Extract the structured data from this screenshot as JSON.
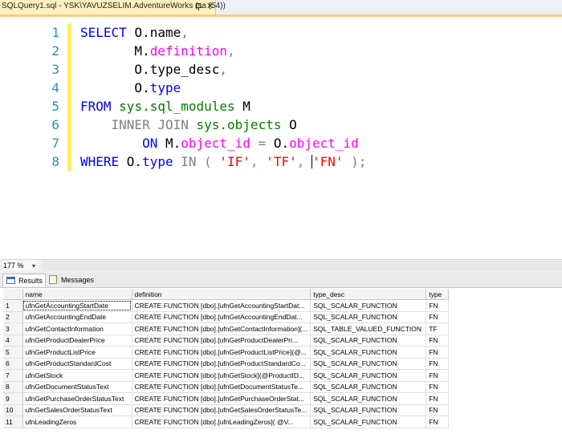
{
  "document_tab": {
    "title": "SQLQuery1.sql - YSK\\YAVUZSELIM.AdventureWorks (sa (54))",
    "pin_icon": "pin-icon",
    "close_label": "✕"
  },
  "editor": {
    "line_numbers": [
      "1",
      "2",
      "3",
      "4",
      "5",
      "6",
      "7",
      "8"
    ],
    "lines": [
      [
        {
          "t": "SELECT ",
          "c": "kw"
        },
        {
          "t": "O.name",
          "c": ""
        },
        {
          "t": ",",
          "c": "gray"
        }
      ],
      [
        {
          "t": "       M.",
          "c": ""
        },
        {
          "t": "definition",
          "c": "fn"
        },
        {
          "t": ",",
          "c": "gray"
        }
      ],
      [
        {
          "t": "       O.type_desc",
          "c": ""
        },
        {
          "t": ",",
          "c": "gray"
        }
      ],
      [
        {
          "t": "       O.",
          "c": ""
        },
        {
          "t": "type",
          "c": "kw"
        }
      ],
      [
        {
          "t": "FROM ",
          "c": "kw"
        },
        {
          "t": "sys.sql_modules",
          "c": "sys"
        },
        {
          "t": " M",
          "c": ""
        }
      ],
      [
        {
          "t": "    ",
          "c": ""
        },
        {
          "t": "INNER JOIN ",
          "c": "gray"
        },
        {
          "t": "sys.objects",
          "c": "sys"
        },
        {
          "t": " O",
          "c": ""
        }
      ],
      [
        {
          "t": "        ",
          "c": ""
        },
        {
          "t": "ON ",
          "c": "kw"
        },
        {
          "t": "M.",
          "c": ""
        },
        {
          "t": "object_id",
          "c": "fn"
        },
        {
          "t": " = ",
          "c": "gray"
        },
        {
          "t": "O.",
          "c": ""
        },
        {
          "t": "object_id",
          "c": "fn"
        }
      ],
      [
        {
          "t": "WHERE ",
          "c": "kw"
        },
        {
          "t": "O.",
          "c": ""
        },
        {
          "t": "type",
          "c": "kw"
        },
        {
          "t": " IN ( ",
          "c": "gray"
        },
        {
          "t": "'IF'",
          "c": "str"
        },
        {
          "t": ", ",
          "c": "gray"
        },
        {
          "t": "'TF'",
          "c": "str"
        },
        {
          "t": ", ",
          "c": "gray"
        },
        {
          "t": "CARET",
          "c": "caret"
        },
        {
          "t": "'FN'",
          "c": "str"
        },
        {
          "t": " );",
          "c": "gray"
        }
      ]
    ]
  },
  "zoom": {
    "value": "177 %"
  },
  "results_tabs": {
    "results": "Results",
    "messages": "Messages"
  },
  "grid": {
    "columns": [
      "name",
      "definition",
      "type_desc",
      "type"
    ],
    "rows": [
      [
        "1",
        "ufnGetAccountingStartDate",
        "CREATE FUNCTION [dbo].[ufnGetAccountingStartDat...",
        "SQL_SCALAR_FUNCTION",
        "FN"
      ],
      [
        "2",
        "ufnGetAccountingEndDate",
        "CREATE FUNCTION [dbo].[ufnGetAccountingEndDat...",
        "SQL_SCALAR_FUNCTION",
        "FN"
      ],
      [
        "3",
        "ufnGetContactInformation",
        "CREATE FUNCTION [dbo].[ufnGetContactInformation](...",
        "SQL_TABLE_VALUED_FUNCTION",
        "TF"
      ],
      [
        "4",
        "ufnGetProductDealerPrice",
        "   CREATE FUNCTION [dbo].[ufnGetProductDealerPri...",
        "SQL_SCALAR_FUNCTION",
        "FN"
      ],
      [
        "5",
        "ufnGetProductListPrice",
        "CREATE FUNCTION [dbo].[ufnGetProductListPrice](@...",
        "SQL_SCALAR_FUNCTION",
        "FN"
      ],
      [
        "6",
        "ufnGetProductStandardCost",
        "CREATE FUNCTION [dbo].[ufnGetProductStandardCo...",
        "SQL_SCALAR_FUNCTION",
        "FN"
      ],
      [
        "7",
        "ufnGetStock",
        "CREATE FUNCTION [dbo].[ufnGetStock](@ProductID...",
        "SQL_SCALAR_FUNCTION",
        "FN"
      ],
      [
        "8",
        "ufnGetDocumentStatusText",
        "CREATE FUNCTION [dbo].[ufnGetDocumentStatusTe...",
        "SQL_SCALAR_FUNCTION",
        "FN"
      ],
      [
        "9",
        "ufnGetPurchaseOrderStatusText",
        "CREATE FUNCTION [dbo].[ufnGetPurchaseOrderStat...",
        "SQL_SCALAR_FUNCTION",
        "FN"
      ],
      [
        "10",
        "ufnGetSalesOrderStatusText",
        "CREATE FUNCTION [dbo].[ufnGetSalesOrderStatusTe...",
        "SQL_SCALAR_FUNCTION",
        "FN"
      ],
      [
        "11",
        "ufnLeadingZeros",
        "CREATE FUNCTION [dbo].[ufnLeadingZeros](       @V...",
        "SQL_SCALAR_FUNCTION",
        "FN"
      ]
    ]
  }
}
